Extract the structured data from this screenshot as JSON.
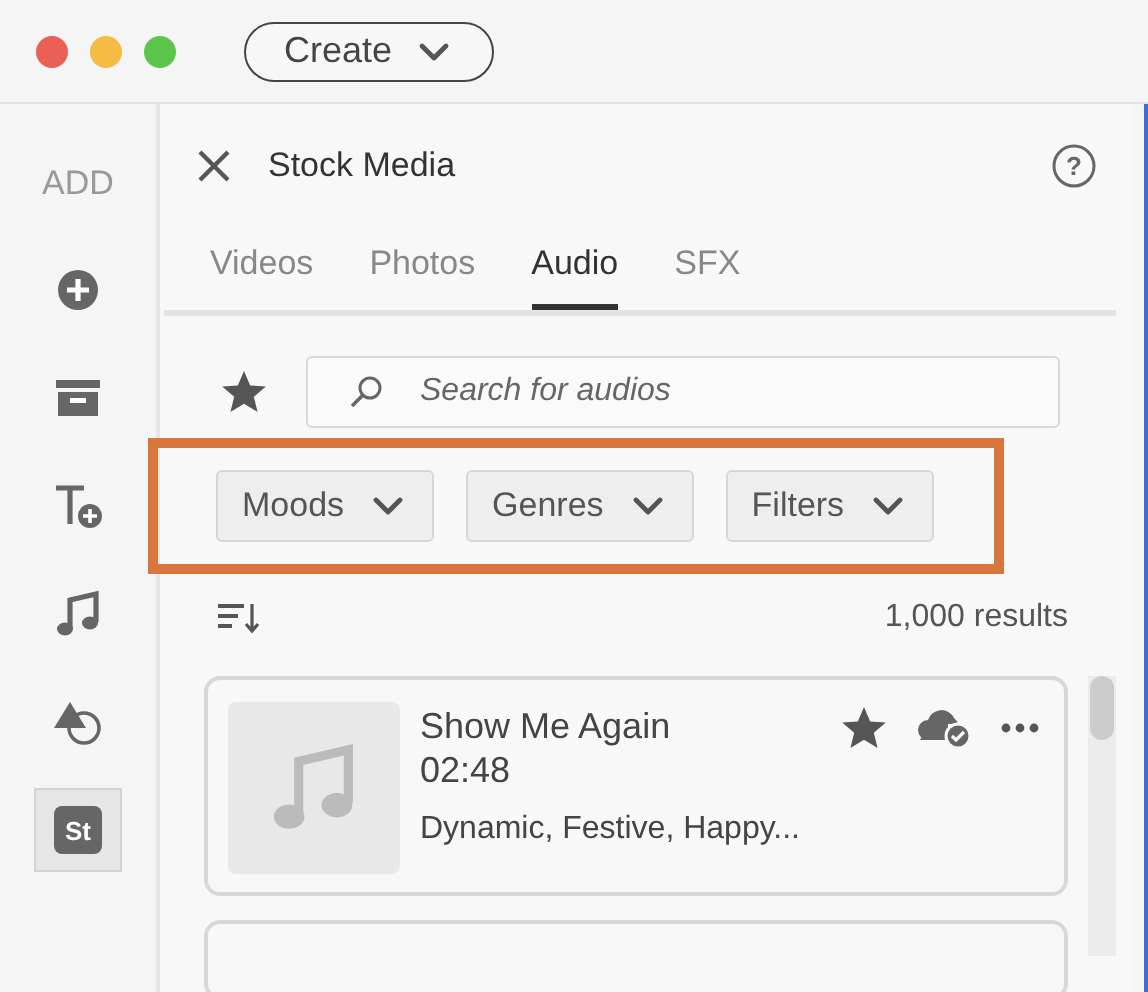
{
  "toolbar": {
    "create_button": "Create"
  },
  "sidebar": {
    "heading": "ADD",
    "items": [
      {
        "kind": "add",
        "selected": false
      },
      {
        "kind": "archive",
        "selected": false
      },
      {
        "kind": "text",
        "selected": false
      },
      {
        "kind": "music",
        "selected": false
      },
      {
        "kind": "shapes",
        "selected": false
      },
      {
        "kind": "stock",
        "label": "St",
        "selected": true
      }
    ]
  },
  "panel": {
    "title": "Stock Media",
    "help": "?",
    "tabs": [
      {
        "label": "Videos",
        "selected": false
      },
      {
        "label": "Photos",
        "selected": false
      },
      {
        "label": "Audio",
        "selected": true
      },
      {
        "label": "SFX",
        "selected": false
      }
    ],
    "search": {
      "placeholder": "Search for audios"
    },
    "filters": [
      "Moods",
      "Genres",
      "Filters"
    ],
    "results": "1,000 results",
    "tracks": [
      {
        "title": "Show Me Again",
        "duration": "02:48",
        "tags": "Dynamic, Festive, Happy..."
      }
    ]
  }
}
